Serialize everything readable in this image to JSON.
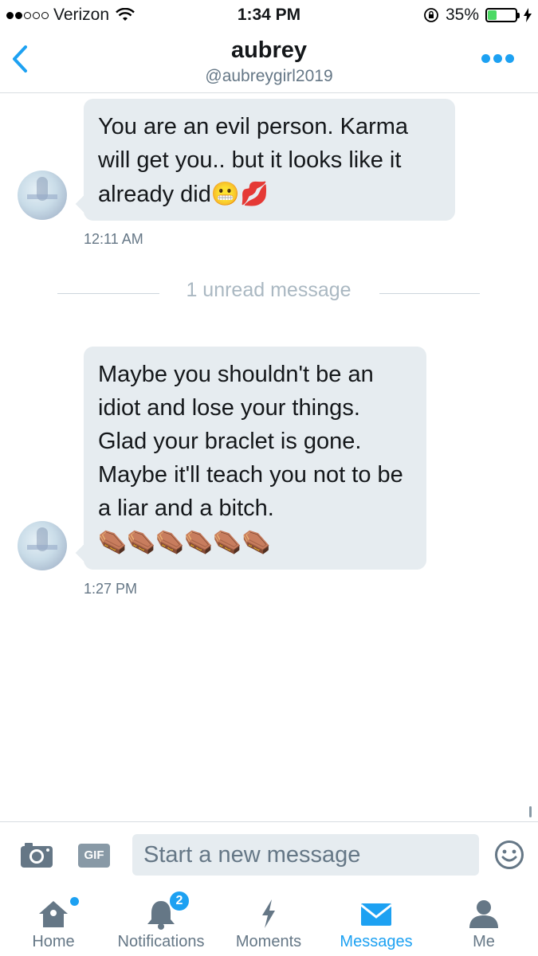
{
  "status_bar": {
    "carrier": "Verizon",
    "time": "1:34 PM",
    "battery": "35%",
    "battery_level": 0.35,
    "signal_bars_filled": 2,
    "signal_bars_total": 5
  },
  "header": {
    "name": "aubrey",
    "handle": "@aubreygirl2019"
  },
  "messages": [
    {
      "text": "You are an evil person. Karma will get you.. but it looks like it already did",
      "emoji": "😬💋",
      "time": "12:11 AM"
    },
    {
      "text": "Maybe you shouldn't be an idiot and lose your things. Glad your braclet is gone. Maybe it'll teach you not to be a liar and a bitch.",
      "emoji": "⚰️⚰️⚰️⚰️⚰️⚰️",
      "time": "1:27 PM"
    }
  ],
  "unread_divider": "1 unread message",
  "compose": {
    "gif_label": "GIF",
    "placeholder": "Start a new message"
  },
  "tabbar": {
    "tabs": [
      {
        "label": "Home",
        "icon": "home-icon"
      },
      {
        "label": "Notifications",
        "icon": "bell-icon",
        "badge": "2"
      },
      {
        "label": "Moments",
        "icon": "lightning-icon"
      },
      {
        "label": "Messages",
        "icon": "envelope-icon",
        "active": true
      },
      {
        "label": "Me",
        "icon": "person-icon"
      }
    ]
  },
  "colors": {
    "accent": "#1da1f2",
    "bubble": "#e6ecf0",
    "secondary_text": "#657786",
    "battery_green": "#4cd964"
  }
}
